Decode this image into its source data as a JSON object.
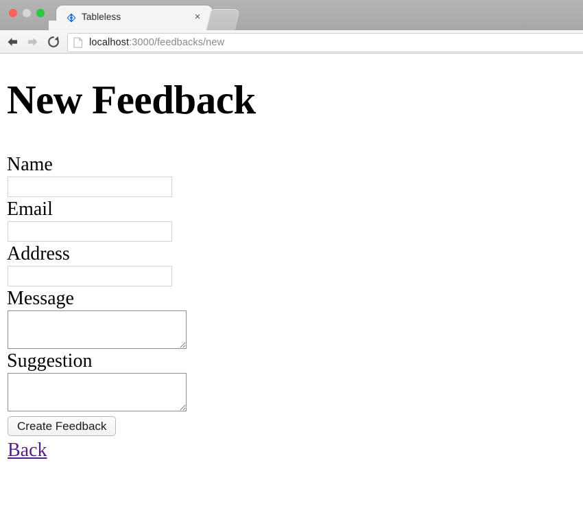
{
  "browser": {
    "traffic_lights": [
      {
        "name": "close",
        "color": "#ff5f57"
      },
      {
        "name": "minimize",
        "color": "#d6d6d6"
      },
      {
        "name": "zoom",
        "color": "#28c840"
      }
    ],
    "tab": {
      "title": "Tableless",
      "favicon_name": "blue-diamond-chevrons-icon",
      "close_label": "×"
    },
    "new_tab_label": "",
    "nav": {
      "back_label": "←",
      "forward_label": "→",
      "reload_label": "↻"
    },
    "omnibox": {
      "icon_name": "page-document-icon",
      "host": "localhost",
      "path": ":3000/feedbacks/new",
      "full_url": "localhost:3000/feedbacks/new"
    }
  },
  "page": {
    "title": "New Feedback",
    "form": {
      "fields": [
        {
          "label": "Name",
          "type": "text",
          "value": "",
          "placeholder": ""
        },
        {
          "label": "Email",
          "type": "text",
          "value": "",
          "placeholder": ""
        },
        {
          "label": "Address",
          "type": "text",
          "value": "",
          "placeholder": ""
        },
        {
          "label": "Message",
          "type": "textarea",
          "value": "",
          "placeholder": ""
        },
        {
          "label": "Suggestion",
          "type": "textarea",
          "value": "",
          "placeholder": ""
        }
      ],
      "submit_label": "Create Feedback",
      "back_label": "Back"
    }
  },
  "colors": {
    "link_visited": "#551a8b",
    "chrome_tabstrip": "#aeaeae",
    "chrome_toolbar": "#f1f1f1",
    "favicon_blue": "#1e6fd9",
    "text": "#000000"
  }
}
